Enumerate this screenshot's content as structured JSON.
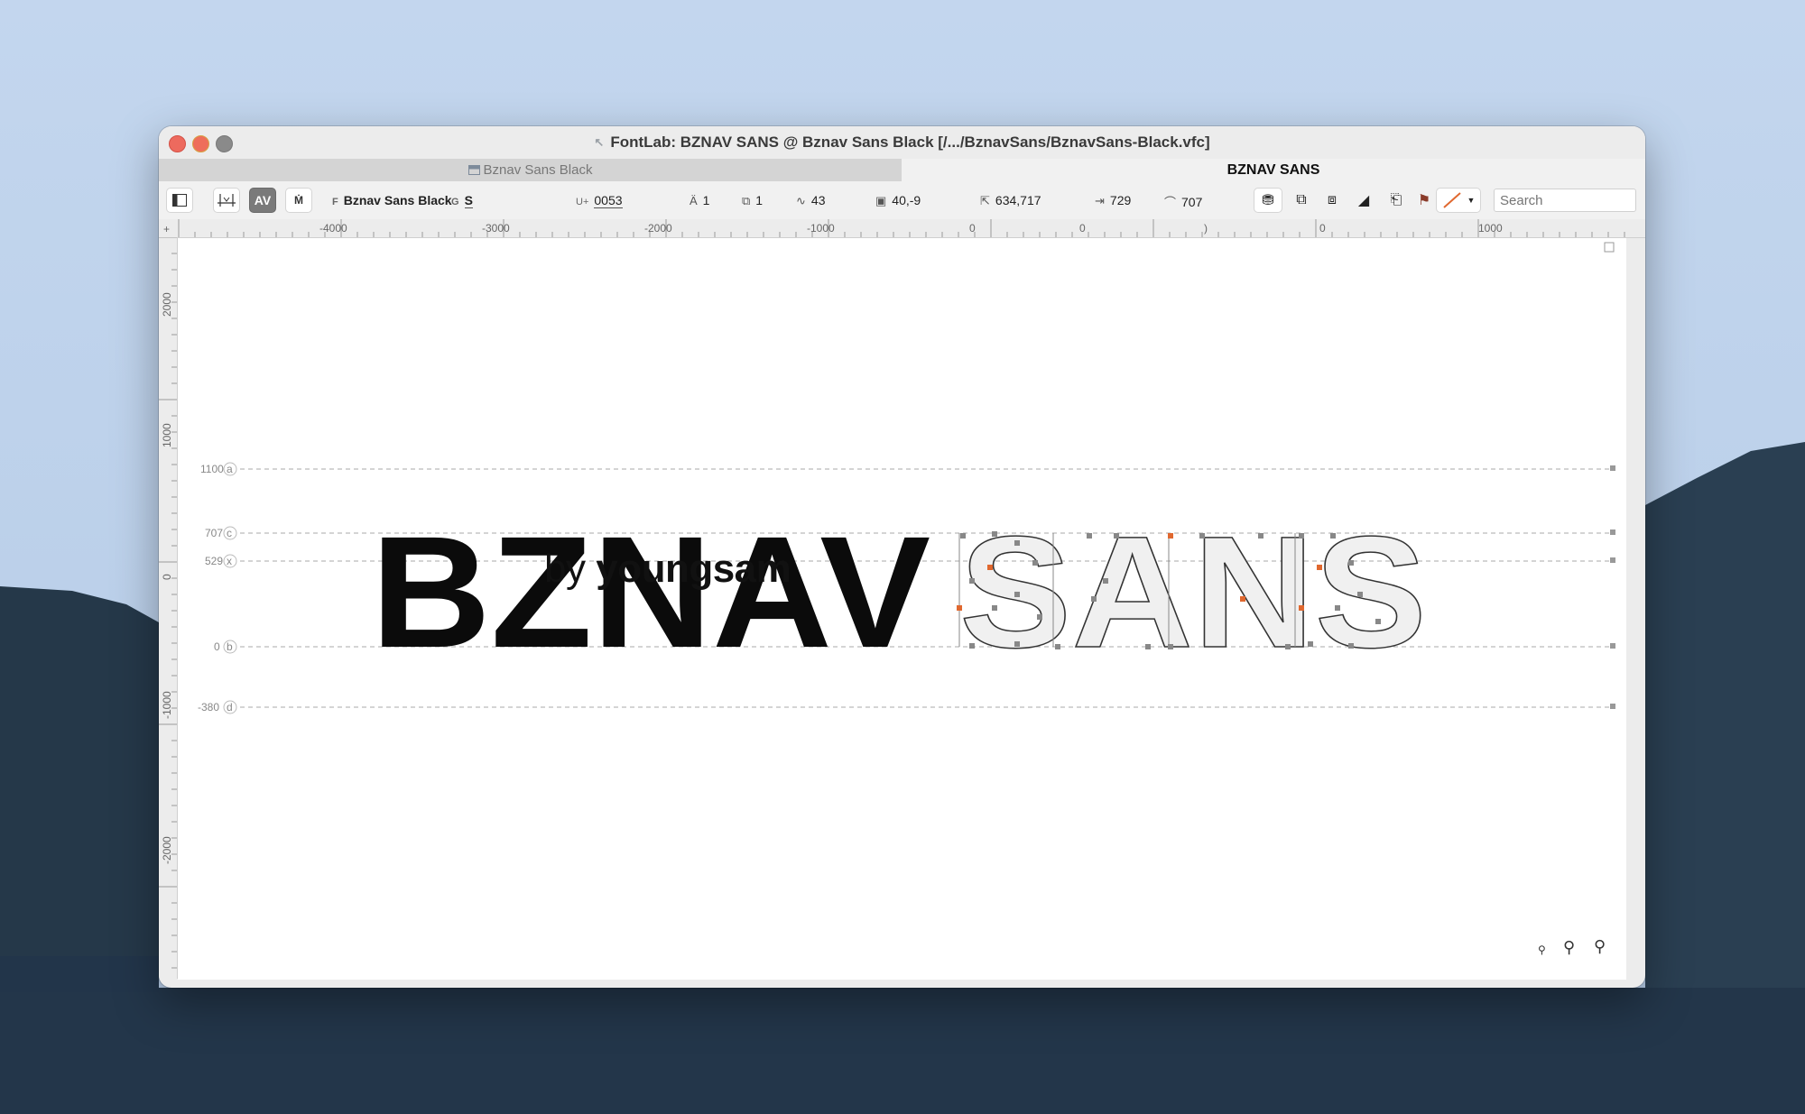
{
  "window": {
    "title": "FontLab: BZNAV SANS @ Bznav Sans Black [/.../BznavSans/BznavSans-Black.vfc]"
  },
  "tabs": [
    {
      "label": "Bznav Sans Black",
      "active": false
    },
    {
      "label": "BZNAV SANS",
      "active": true
    }
  ],
  "toolbar": {
    "font_label": "F",
    "font_name": "Bznav Sans Black",
    "glyph_label": "G",
    "glyph_name": "S",
    "unicode_label": "U+",
    "unicode_value": "0053",
    "layers_count": "1",
    "elements_count": "1",
    "nodes_count": "43",
    "coordinates": "40,-9",
    "dimensions": "634,717",
    "advance_width": "729",
    "height_value": "707",
    "accent_color": "#e0682f",
    "search_placeholder": "Search"
  },
  "rulers": {
    "top_ticks": [
      "-4000",
      "-3000",
      "-2000",
      "-1000",
      "0",
      "0",
      ")",
      "0",
      "1000"
    ],
    "left_ticks": [
      "2000",
      "1000",
      "0",
      "-1000",
      "-2000"
    ]
  },
  "metrics": [
    {
      "value": "1100",
      "tag": "a"
    },
    {
      "value": "707",
      "tag": "c"
    },
    {
      "value": "529",
      "tag": "x"
    },
    {
      "value": "0",
      "tag": "b"
    },
    {
      "value": "-380",
      "tag": "d"
    }
  ],
  "text": {
    "byline_prefix": "by",
    "byline_author": "youngsam",
    "filled_glyphs": "BZNAV",
    "outline_glyphs": "SANS"
  },
  "zoom_icons": [
    "zoom-out-icon",
    "zoom-in-icon",
    "zoom-selection-icon"
  ]
}
